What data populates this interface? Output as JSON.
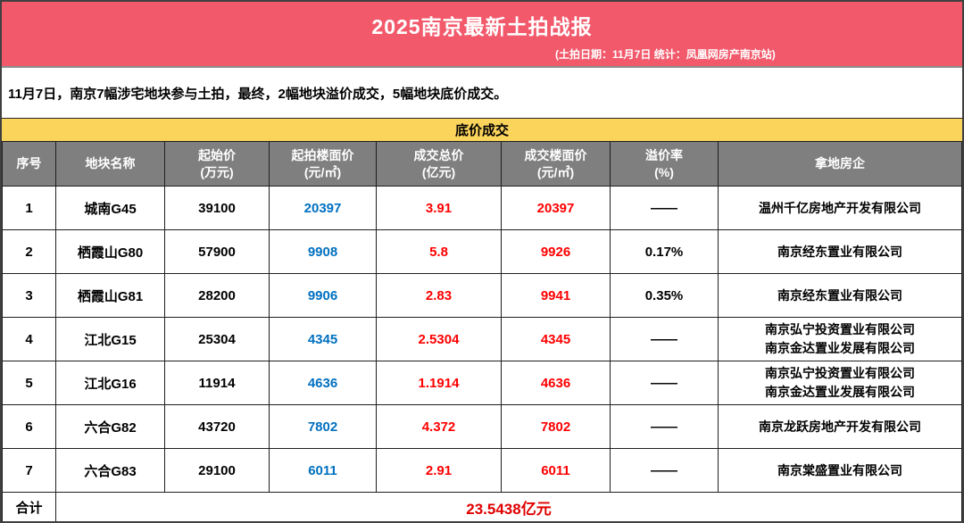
{
  "banner": {
    "title": "2025南京最新土拍战报",
    "subtitle": "(土拍日期：11月7日  统计：凤凰网房产南京站)",
    "bg_color": "#F25A6C"
  },
  "summary": "11月7日，南京7幅涉宅地块参与土拍，最终，2幅地块溢价成交，5幅地块底价成交。",
  "section_bar": {
    "label": "底价成交",
    "bg_color": "#FBD45C"
  },
  "table": {
    "header_bg": "#7F7F7F",
    "accent_colors": {
      "start_floor_price": "#0070C0",
      "deal_total_price": "#FF0000",
      "deal_floor_price": "#FF0000"
    },
    "columns": [
      "序号",
      "地块名称",
      "起始价\n(万元)",
      "起拍楼面价\n(元/㎡)",
      "成交总价\n(亿元)",
      "成交楼面价\n(元/㎡)",
      "溢价率\n(%)",
      "拿地房企"
    ],
    "rows": [
      {
        "no": "1",
        "plot": "城南G45",
        "start_price": "39100",
        "start_floor": "20397",
        "deal_total": "3.91",
        "deal_floor": "20397",
        "premium": "——",
        "buyer": "温州千亿房地产开发有限公司"
      },
      {
        "no": "2",
        "plot": "栖霞山G80",
        "start_price": "57900",
        "start_floor": "9908",
        "deal_total": "5.8",
        "deal_floor": "9926",
        "premium": "0.17%",
        "buyer": "南京经东置业有限公司"
      },
      {
        "no": "3",
        "plot": "栖霞山G81",
        "start_price": "28200",
        "start_floor": "9906",
        "deal_total": "2.83",
        "deal_floor": "9941",
        "premium": "0.35%",
        "buyer": "南京经东置业有限公司"
      },
      {
        "no": "4",
        "plot": "江北G15",
        "start_price": "25304",
        "start_floor": "4345",
        "deal_total": "2.5304",
        "deal_floor": "4345",
        "premium": "——",
        "buyer": "南京弘宁投资置业有限公司\n南京金达置业发展有限公司"
      },
      {
        "no": "5",
        "plot": "江北G16",
        "start_price": "11914",
        "start_floor": "4636",
        "deal_total": "1.1914",
        "deal_floor": "4636",
        "premium": "——",
        "buyer": "南京弘宁投资置业有限公司\n南京金达置业发展有限公司"
      },
      {
        "no": "6",
        "plot": "六合G82",
        "start_price": "43720",
        "start_floor": "7802",
        "deal_total": "4.372",
        "deal_floor": "7802",
        "premium": "——",
        "buyer": "南京龙跃房地产开发有限公司"
      },
      {
        "no": "7",
        "plot": "六合G83",
        "start_price": "29100",
        "start_floor": "6011",
        "deal_total": "2.91",
        "deal_floor": "6011",
        "premium": "——",
        "buyer": "南京棠盛置业有限公司"
      }
    ],
    "footer": {
      "label": "合计",
      "total": "23.5438亿元"
    }
  }
}
